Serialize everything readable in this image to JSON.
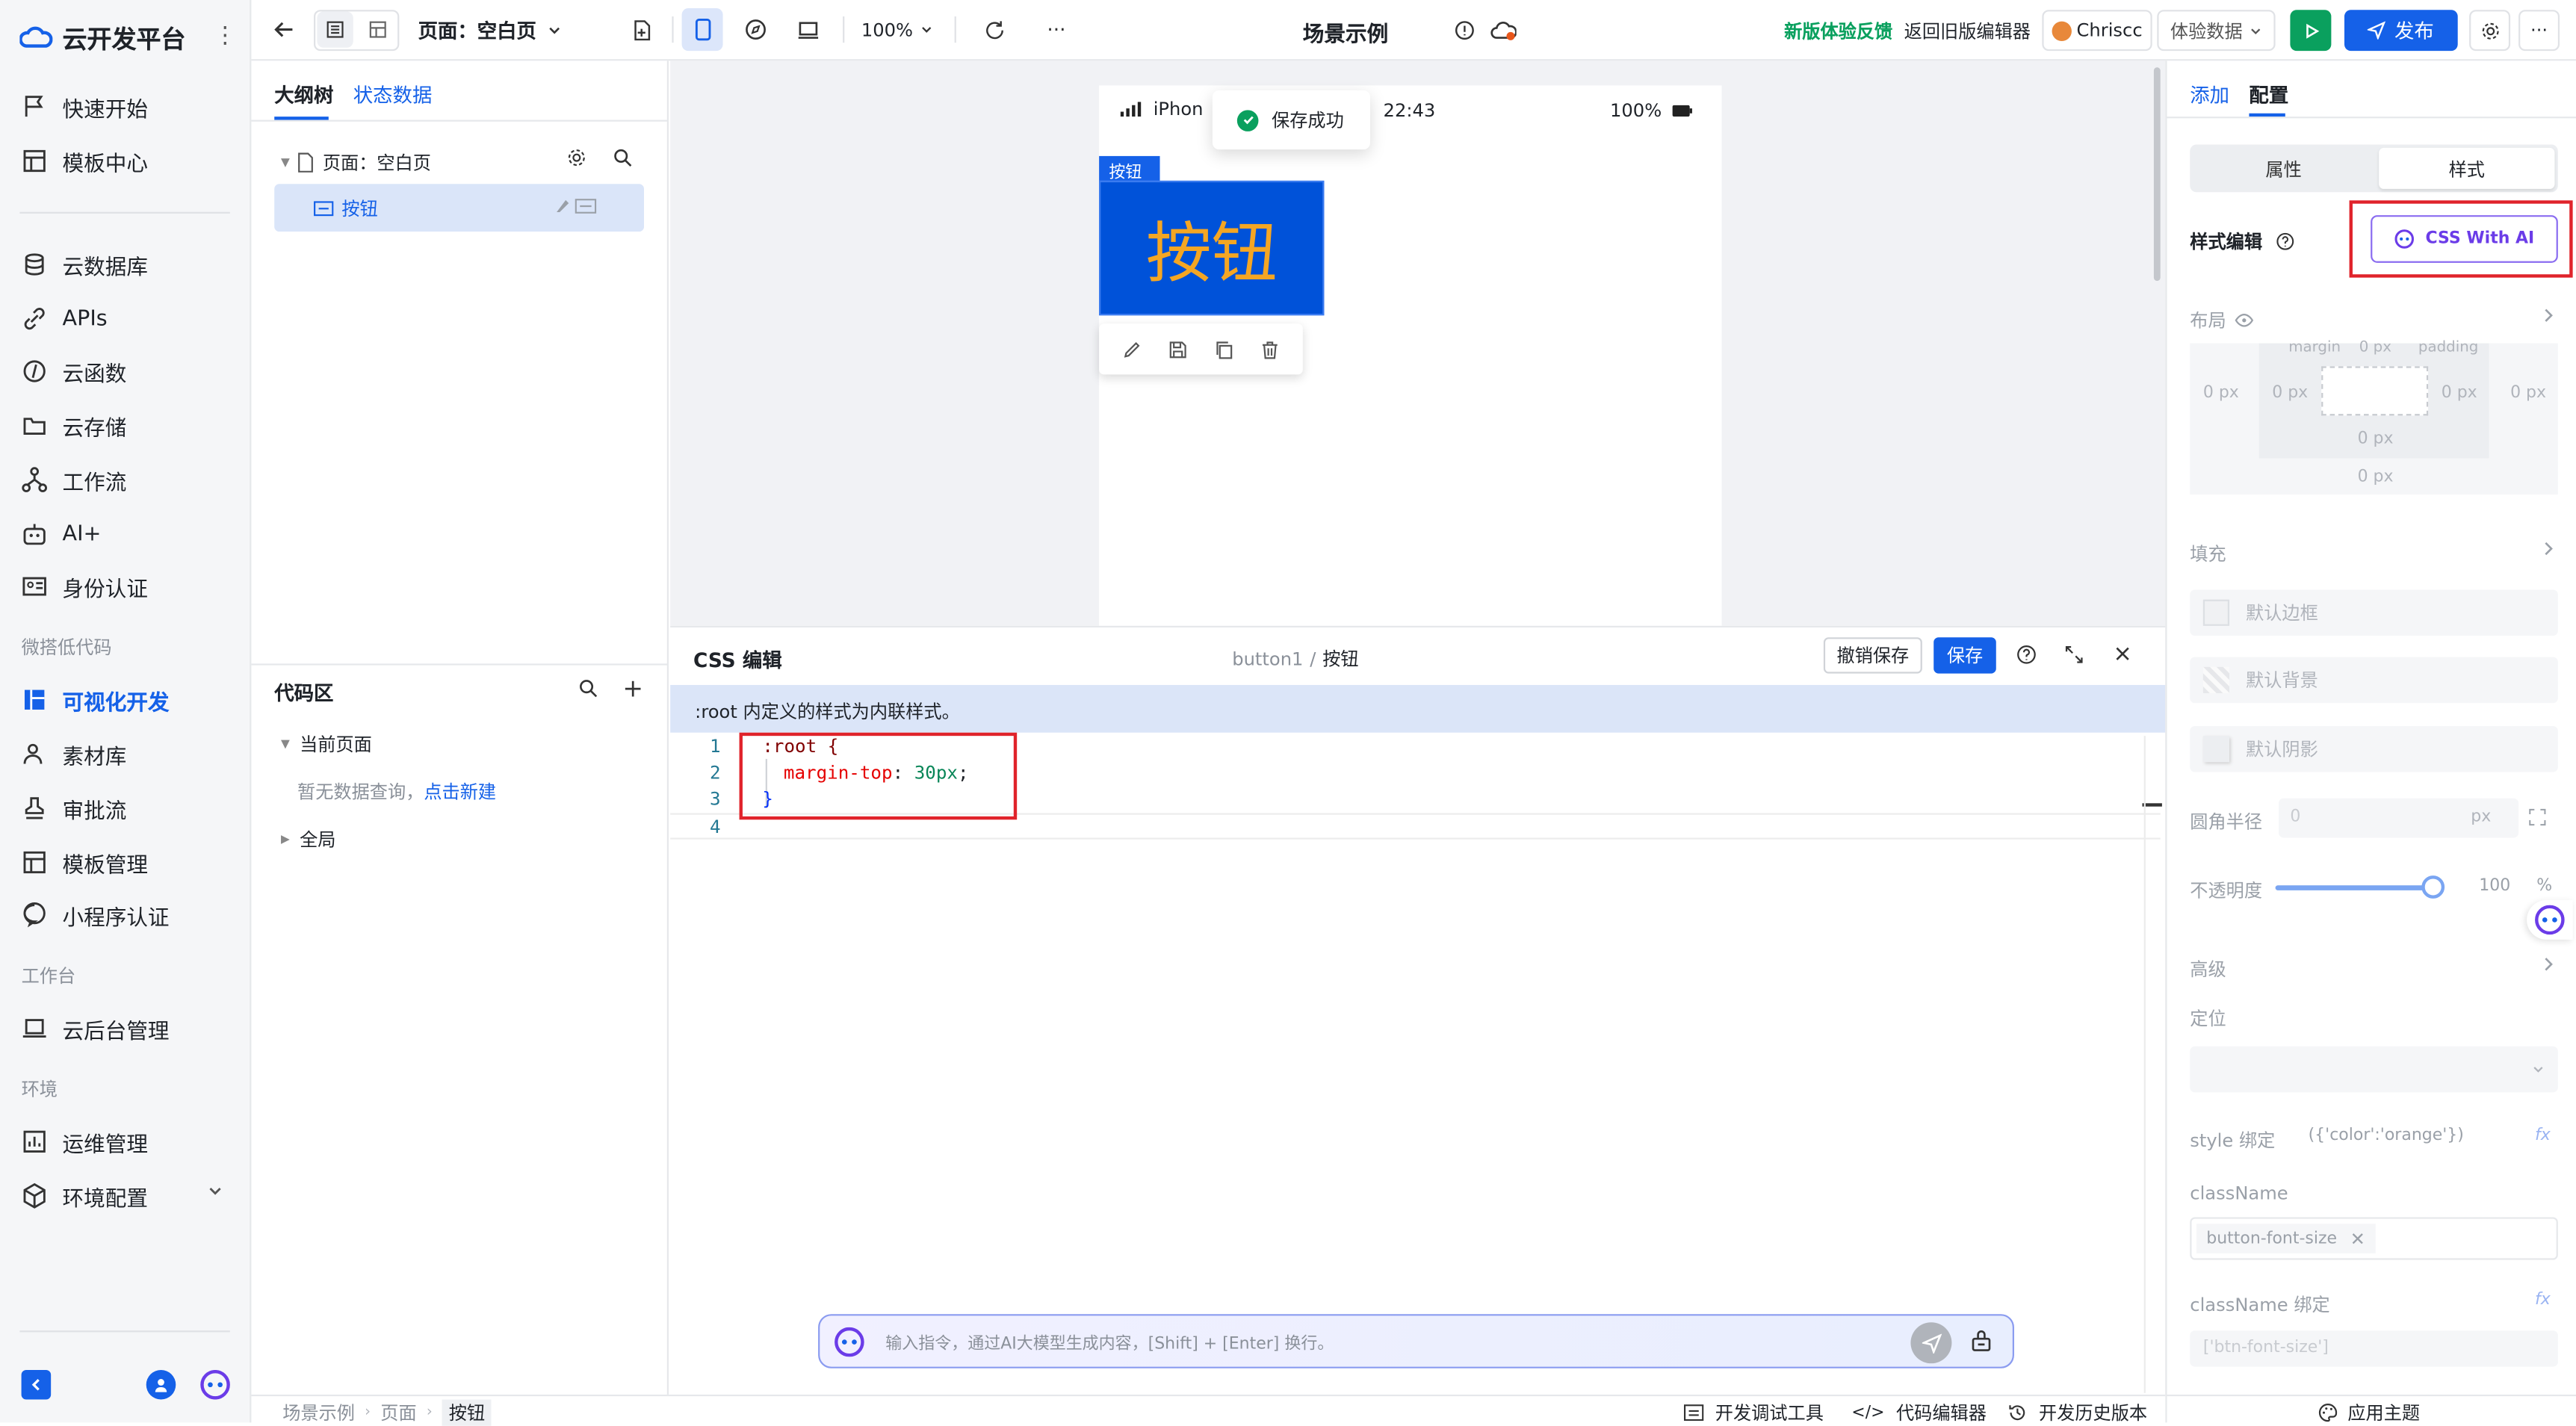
{
  "sidebar": {
    "logo_text": "云开发平台",
    "items_top": [
      {
        "label": "快速开始",
        "icon": "flag-icon"
      },
      {
        "label": "模板中心",
        "icon": "template-icon"
      }
    ],
    "items_mid": [
      {
        "label": "云数据库",
        "icon": "database-icon"
      },
      {
        "label": "APIs",
        "icon": "link-icon"
      },
      {
        "label": "云函数",
        "icon": "function-icon"
      },
      {
        "label": "云存储",
        "icon": "folder-icon"
      },
      {
        "label": "工作流",
        "icon": "workflow-icon"
      },
      {
        "label": "AI+",
        "icon": "robot-icon"
      },
      {
        "label": "身份认证",
        "icon": "id-card-icon"
      }
    ],
    "section_lowcode": "微搭低代码",
    "items_lowcode": [
      {
        "label": "可视化开发",
        "icon": "layout-icon",
        "active": true
      },
      {
        "label": "素材库",
        "icon": "users-icon"
      },
      {
        "label": "审批流",
        "icon": "stamp-icon"
      },
      {
        "label": "模板管理",
        "icon": "template-manage-icon"
      },
      {
        "label": "小程序认证",
        "icon": "chat-icon"
      }
    ],
    "section_workbench": "工作台",
    "items_workbench": [
      {
        "label": "云后台管理",
        "icon": "laptop-icon"
      }
    ],
    "section_env": "环境",
    "items_env": [
      {
        "label": "运维管理",
        "icon": "chart-icon"
      },
      {
        "label": "环境配置",
        "icon": "cube-icon"
      }
    ]
  },
  "topbar": {
    "page_select": "页面：空白页",
    "zoom": "100%",
    "title": "场景示例",
    "feedback": "新版体验反馈",
    "back_old": "返回旧版编辑器",
    "user": "Chriscc",
    "data_select": "体验数据",
    "publish": "发布",
    "more": "···"
  },
  "outline": {
    "tab_tree": "大纲树",
    "tab_state": "状态数据",
    "page_node": "页面：空白页",
    "button_node": "按钮",
    "code_title": "代码区",
    "current_page": "当前页面",
    "no_query": "暂无数据查询，",
    "create_new": "点击新建",
    "global": "全局"
  },
  "canvas": {
    "status_carrier": "iPhon",
    "status_time": "22:43",
    "status_battery": "100%",
    "toast": "保存成功",
    "selected_tag": "按钮",
    "button_text": "按钮"
  },
  "css_editor": {
    "title": "CSS 编辑",
    "breadcrumb_component": "button1",
    "breadcrumb_sep": "/",
    "breadcrumb_name": "按钮",
    "revert": "撤销保存",
    "save": "保存",
    "info": ":root 内定义的样式为内联样式。",
    "line_numbers": [
      "1",
      "2",
      "3",
      "4"
    ],
    "code_line1": ":root {",
    "code_line2_prop": "margin-top",
    "code_line2_colon": ":",
    "code_line2_value": "30px",
    "code_line2_semi": ";",
    "code_line3": "}",
    "ai_placeholder": "输入指令，通过AI大模型生成内容，[Shift] + [Enter] 换行。"
  },
  "right_panel": {
    "tab_add": "添加",
    "tab_config": "配置",
    "seg_props": "属性",
    "seg_style": "样式",
    "style_edit": "样式编辑",
    "css_ai": "CSS With AI",
    "layout": "布局",
    "margin_top_label": "margin",
    "padding_label": "padding",
    "box_values": {
      "outer_left": "0 px",
      "inner_left": "0 px",
      "inner_right": "0 px",
      "outer_right": "0 px",
      "inner_bottom": "0 px",
      "outer_bottom": "0 px",
      "top": "0 px"
    },
    "fill": "填充",
    "default_border": "默认边框",
    "default_bg": "默认背景",
    "default_shadow": "默认阴影",
    "radius": "圆角半径",
    "radius_value": "0",
    "radius_unit": "px",
    "opacity": "不透明度",
    "opacity_value": "100",
    "opacity_unit": "%",
    "opacity_level": 1.0,
    "advanced": "高级",
    "position": "定位",
    "style_binding": "style 绑定",
    "style_binding_value": "({'color':'orange'})",
    "classname": "className",
    "classname_tag": "button-font-size",
    "classname_binding": "className 绑定",
    "classname_binding_value": "['btn-font-size']"
  },
  "bottombar": {
    "crumbs": [
      "场景示例",
      "页面",
      "按钮"
    ],
    "dev_tools": "开发调试工具",
    "code_editor": "代码编辑器",
    "history": "开发历史版本",
    "theme": "应用主题"
  },
  "colors": {
    "primary": "#1561e8",
    "button_bg": "#0052d9",
    "button_text": "#f5a623",
    "feedback_green": "#0aa05e",
    "highlight_red": "#e0232b",
    "ai_purple": "#6b3ce8"
  }
}
